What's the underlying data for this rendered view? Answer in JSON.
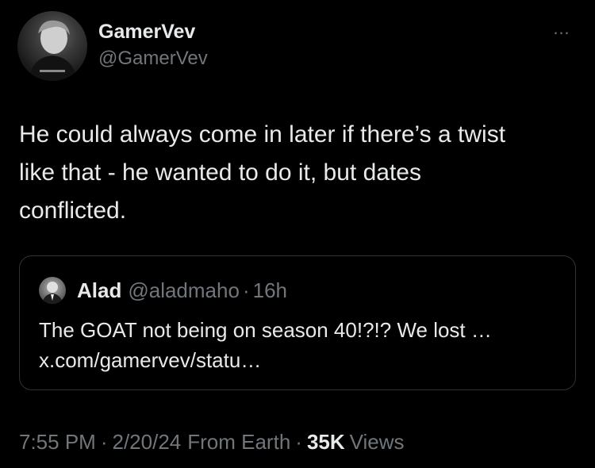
{
  "author": {
    "display_name": "GamerVev",
    "handle": "@GamerVev"
  },
  "tweet": {
    "text": "He could always come in later if there’s a twist\nlike that - he wanted to do it, but dates\nconflicted.",
    "more_icon": "…"
  },
  "quote": {
    "display_name": "Alad",
    "handle": "@aladmaho",
    "separator": "·",
    "time": "16h",
    "text_line1": "The GOAT not being on season 40!?!? We lost …",
    "text_line2": "x.com/gamervev/statu…"
  },
  "meta": {
    "time": "7:55 PM",
    "separator": "·",
    "date": "2/20/24",
    "location": "From Earth",
    "views_count": "35K",
    "views_label": "Views"
  },
  "colors": {
    "background": "#000000",
    "text": "#e7e9ea",
    "secondary": "#71767b",
    "border": "#2f3336"
  }
}
